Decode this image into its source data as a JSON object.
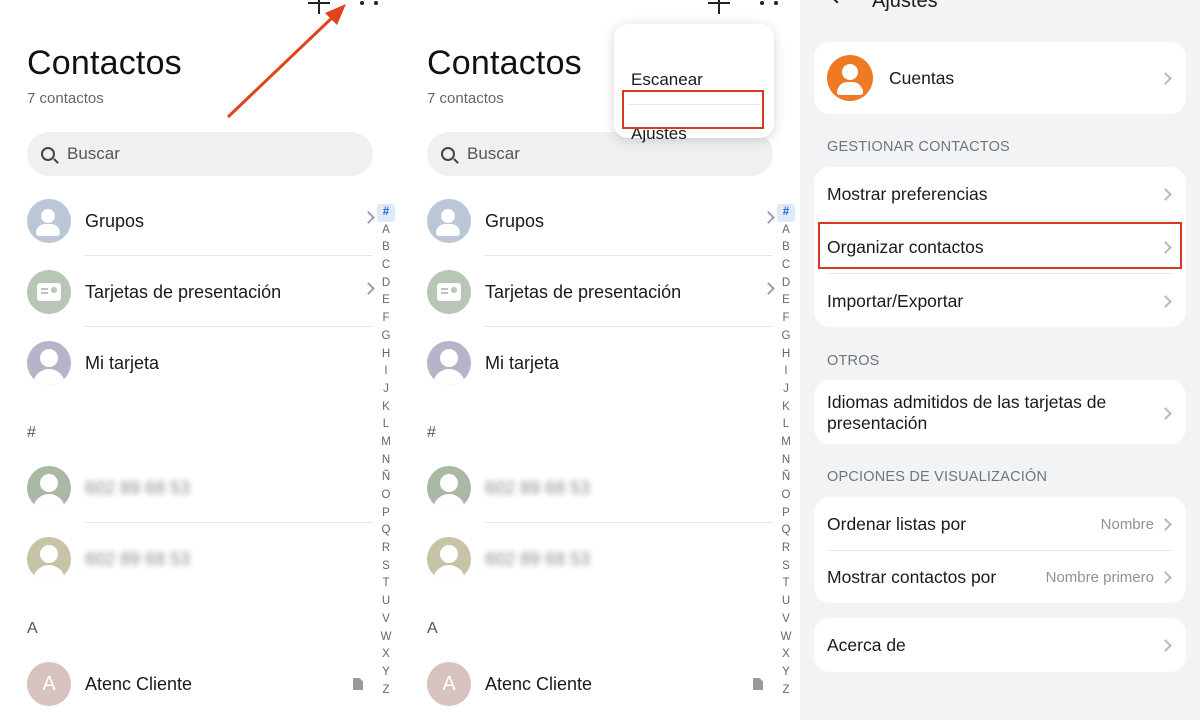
{
  "contacts": {
    "title": "Contactos",
    "count": "7 contactos",
    "search_placeholder": "Buscar",
    "items": {
      "groups": "Grupos",
      "cards": "Tarjetas de presentación",
      "mine": "Mi tarjeta"
    },
    "section_hash": "#",
    "section_a": "A",
    "blurred_contact_1": "602 89 68 53",
    "blurred_contact_2": "602 89 68 53",
    "contact_a_initial": "A",
    "contact_a_name": "Atenc Cliente",
    "alphabet": [
      "#",
      "A",
      "B",
      "C",
      "D",
      "E",
      "F",
      "G",
      "H",
      "I",
      "J",
      "K",
      "L",
      "M",
      "N",
      "Ñ",
      "O",
      "P",
      "Q",
      "R",
      "S",
      "T",
      "U",
      "V",
      "W",
      "X",
      "Y",
      "Z"
    ]
  },
  "menu": {
    "scan": "Escanear",
    "settings": "Ajustes"
  },
  "settings": {
    "title": "Ajustes",
    "accounts": "Cuentas",
    "section_manage": "GESTIONAR CONTACTOS",
    "show_prefs": "Mostrar preferencias",
    "organize": "Organizar contactos",
    "import_export": "Importar/Exportar",
    "section_other": "OTROS",
    "card_languages": "Idiomas admitidos de las tarjetas de presentación",
    "section_display": "OPCIONES DE VISUALIZACIÓN",
    "sort_by": "Ordenar listas por",
    "sort_by_value": "Nombre",
    "show_by": "Mostrar contactos por",
    "show_by_value": "Nombre primero",
    "about": "Acerca de"
  },
  "colors": {
    "highlight": "#d43b22",
    "accent_orange": "#f07a23",
    "index_selected": "#1c6dd0"
  }
}
